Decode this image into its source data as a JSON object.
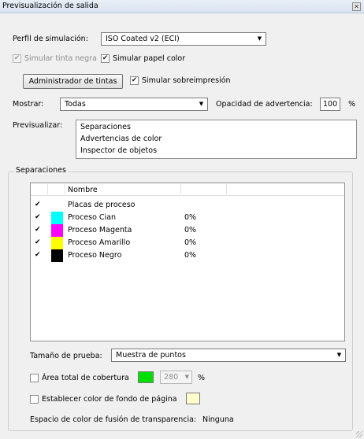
{
  "window": {
    "title": "Previsualización de salida",
    "close_glyph": "✕"
  },
  "profile": {
    "label": "Perfil de simulación:",
    "value": "ISO Coated v2 (ECI)"
  },
  "sim_black_ink": {
    "label": "Simular tinta negra",
    "checked": true,
    "enabled": false
  },
  "sim_paper_color": {
    "label": "Simular papel color",
    "checked": true
  },
  "ink_manager_button": {
    "label": "Administrador de tintas"
  },
  "sim_overprint": {
    "label": "Simular sobreimpresión",
    "checked": true
  },
  "show": {
    "label": "Mostrar:",
    "value": "Todas"
  },
  "warning_opacity": {
    "label": "Opacidad de advertencia:",
    "value": "100",
    "unit": "%"
  },
  "preview": {
    "label": "Previsualizar:",
    "items": [
      "Separaciones",
      "Advertencias de color",
      "Inspector de objetos"
    ]
  },
  "separations": {
    "title": "Separaciones",
    "column_name": "Nombre",
    "rows": [
      {
        "name": "Placas de proceso",
        "percent": "",
        "swatch": "",
        "checked": true
      },
      {
        "name": "Proceso Cian",
        "percent": "0%",
        "swatch": "#00ffff",
        "checked": true
      },
      {
        "name": "Proceso Magenta",
        "percent": "0%",
        "swatch": "#ff00ff",
        "checked": true
      },
      {
        "name": "Proceso Amarillo",
        "percent": "0%",
        "swatch": "#ffff00",
        "checked": true
      },
      {
        "name": "Proceso Negro",
        "percent": "0%",
        "swatch": "#000000",
        "checked": true
      }
    ]
  },
  "sample_size": {
    "label": "Tamaño de prueba:",
    "value": "Muestra de puntos"
  },
  "total_coverage": {
    "label": "Área total de cobertura",
    "checked": false,
    "color": "#00e000",
    "value": "280",
    "unit": "%"
  },
  "page_bg_color": {
    "label": "Establecer color de fondo de página",
    "checked": false,
    "color": "#ffffcc"
  },
  "blend_space": {
    "label": "Espacio de color de fusión de transparencia:",
    "value": "Ninguna"
  },
  "glyphs": {
    "check": "✔",
    "arrow_down": "▼"
  }
}
